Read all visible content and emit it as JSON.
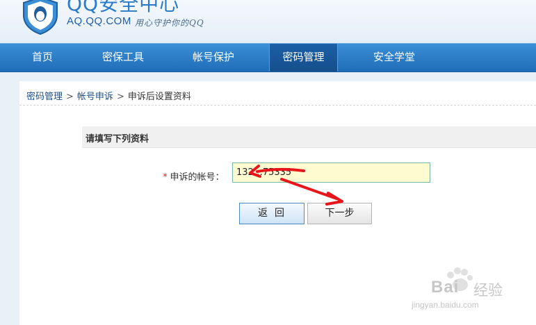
{
  "header": {
    "title": "QQ安全中心",
    "url": "AQ.QQ.COM",
    "slogan": "用心守护你的QQ"
  },
  "nav": {
    "items": [
      {
        "label": "首页"
      },
      {
        "label": "密保工具"
      },
      {
        "label": "帐号保护"
      },
      {
        "label": "密码管理"
      },
      {
        "label": "安全学堂"
      }
    ],
    "active": "密码管理"
  },
  "breadcrumb": {
    "items": [
      "密码管理",
      "帐号申诉",
      "申诉后设置资料"
    ],
    "separator": ">"
  },
  "form": {
    "section_title": "请填写下列资料",
    "required_mark": "*",
    "account_label": "申诉的帐号：",
    "account_value": "132…75335"
  },
  "buttons": {
    "back": "返回",
    "next": "下一步"
  },
  "watermark": {
    "brand": "Bai",
    "brand_cn": "经验",
    "url": "jingyan.baidu.com"
  },
  "colors": {
    "nav_bg": "#2a7fcc",
    "nav_active": "#164f8d",
    "annotation_arrow": "#e8161b",
    "input_bg": "#fffbd0"
  },
  "icons": {
    "logo": "qq-penguin-shield-icon",
    "breadcrumb_separator": "chevron-right-icon",
    "annotation": "red-arrow-icon",
    "watermark": "baidu-paw-icon"
  }
}
